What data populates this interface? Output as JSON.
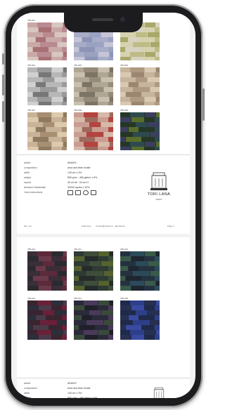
{
  "brand": {
    "name": "TORI LANA",
    "sub": "PARIS"
  },
  "spec_labels": [
    "article",
    "composition",
    "width",
    "weight",
    "repeat",
    "Abrasion Martindale",
    "Care instructions"
  ],
  "spec_values": [
    "ARAVIS",
    "wool and linen inside",
    "140 cm ± 3%",
    "850 g/m²  ·  480 g/lmm ± 5%",
    "30 cm W  ·  20 cm H",
    "30000 cycles ± 10%"
  ],
  "footer": {
    "page_no": "Ref. 1/2",
    "company": "Aufie Rue",
    "contact": "contact@toriana.fr  ·  @toriana.fr",
    "page_label": "Page 1"
  },
  "colors": {
    "phone_frame": "#1c1c1e",
    "screen_bg": "#f2f2f2",
    "page_bg": "#ffffff"
  },
  "swatches_top": [
    {
      "label": "785-001",
      "palette": [
        "#c9a9a6",
        "#b98a92",
        "#d8c6c0",
        "#a87074"
      ]
    },
    {
      "label": "785-002",
      "palette": [
        "#a7acc7",
        "#9aa2c1",
        "#c6c4d6",
        "#8e94b5"
      ]
    },
    {
      "label": "785-003",
      "palette": [
        "#d6d2b0",
        "#bfbb86",
        "#a8a86a",
        "#d7d3c1"
      ]
    },
    {
      "label": "785-004",
      "palette": [
        "#b7b7b7",
        "#9a9a9a",
        "#d0d0d0",
        "#777777"
      ]
    },
    {
      "label": "785-005",
      "palette": [
        "#b0a694",
        "#968b78",
        "#c8bfae",
        "#7c7464"
      ]
    },
    {
      "label": "785-006",
      "palette": [
        "#c7b49c",
        "#ae9a82",
        "#d9c9b3",
        "#9c8672"
      ]
    },
    {
      "label": "785-007",
      "palette": [
        "#c8b39a",
        "#a88f72",
        "#ddc9ac",
        "#8f7a60"
      ]
    },
    {
      "label": "785-008",
      "palette": [
        "#c99d91",
        "#b3443f",
        "#d6b9a8",
        "#9e6a5e"
      ]
    },
    {
      "label": "785-009",
      "palette": [
        "#253627",
        "#2e4a4f",
        "#3b3f5f",
        "#5a6e2c"
      ]
    }
  ],
  "swatches_bottom": [
    {
      "label": "785-010",
      "palette": [
        "#3a2e38",
        "#5c2a3a",
        "#2a2a30",
        "#6a3a4a"
      ]
    },
    {
      "label": "785-011",
      "palette": [
        "#2e3a33",
        "#3f4e3a",
        "#55622e",
        "#252a2a"
      ]
    },
    {
      "label": "785-012",
      "palette": [
        "#243240",
        "#2d4a5a",
        "#3a5a4a",
        "#1e2630"
      ]
    },
    {
      "label": "785-013",
      "palette": [
        "#3a2430",
        "#6a2038",
        "#2a2f3a",
        "#4a3a4a"
      ]
    },
    {
      "label": "785-014",
      "palette": [
        "#2a2a3a",
        "#4a3a5a",
        "#3a4a3a",
        "#1f2029"
      ]
    },
    {
      "label": "785-015",
      "palette": [
        "#1f2a4a",
        "#2e3f8a",
        "#273050",
        "#3a4aa0"
      ]
    }
  ]
}
